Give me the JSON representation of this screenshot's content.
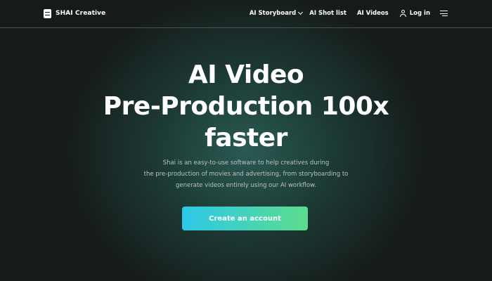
{
  "brand": {
    "name": "SHAI Creative",
    "logo_icon": "shai-logo-icon"
  },
  "nav": {
    "storyboard": "AI Storyboard",
    "shotlist": "AI Shot list",
    "videos": "AI Videos",
    "login": "Log in",
    "icons": [
      "chevron-down-icon",
      "user-icon",
      "menu-icon"
    ]
  },
  "hero": {
    "title_lines": [
      "AI Video",
      "Pre-Production 100x",
      "faster"
    ],
    "subtitle_lines": [
      "Shai is an easy-to-use software to help creatives during",
      "the pre-production of movies and advertising, from storyboarding to",
      "generate videos entirely using our AI workflow."
    ],
    "cta_label": "Create an account"
  },
  "colors": {
    "background": "#161b1a",
    "glow": "#2a5a52",
    "cta_gradient_start": "#2dc8e8",
    "cta_gradient_end": "#5ddc8c",
    "text": "#ffffff",
    "subtitle": "#b9c3c0"
  }
}
